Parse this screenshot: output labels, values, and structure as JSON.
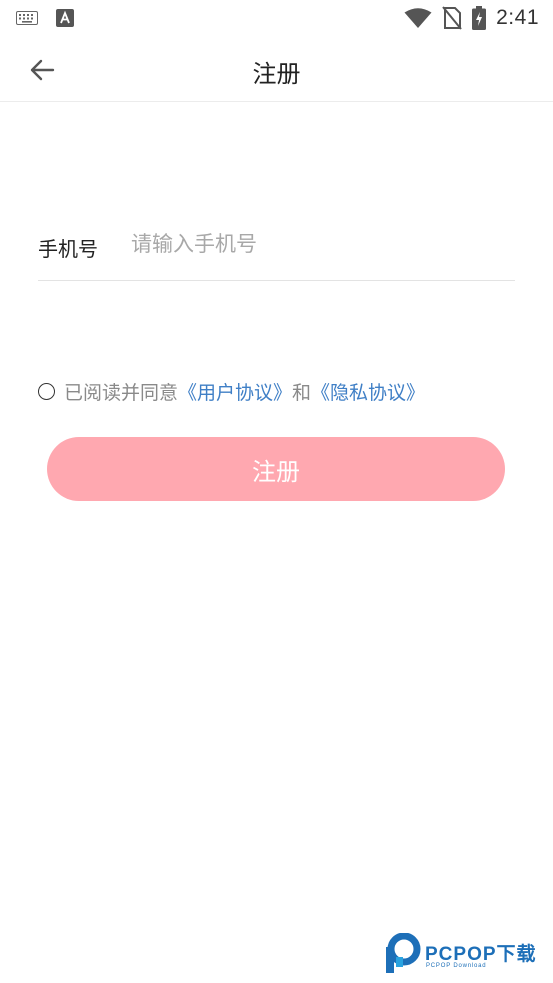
{
  "status_bar": {
    "time": "2:41",
    "left_icons": [
      "keyboard-icon",
      "a-badge-icon"
    ],
    "right_icons": [
      "wifi-icon",
      "no-sim-icon",
      "battery-charging-icon"
    ]
  },
  "app_bar": {
    "title": "注册",
    "back_icon": "arrow-left-icon"
  },
  "form": {
    "phone_label": "手机号",
    "phone_placeholder": "请输入手机号",
    "phone_value": ""
  },
  "agreement": {
    "checked": false,
    "text_prefix": "已阅读并同意",
    "user_agreement": "《用户协议》",
    "conjunction": "和",
    "privacy_policy": "《隐私协议》"
  },
  "submit": {
    "label": "注册"
  },
  "watermark": {
    "title": "PCPOP下载",
    "subtitle": "PCPOP Download"
  },
  "colors": {
    "accent_button": "#ffa8b0",
    "link": "#3f7fc6",
    "watermark": "#1d6fb8"
  }
}
